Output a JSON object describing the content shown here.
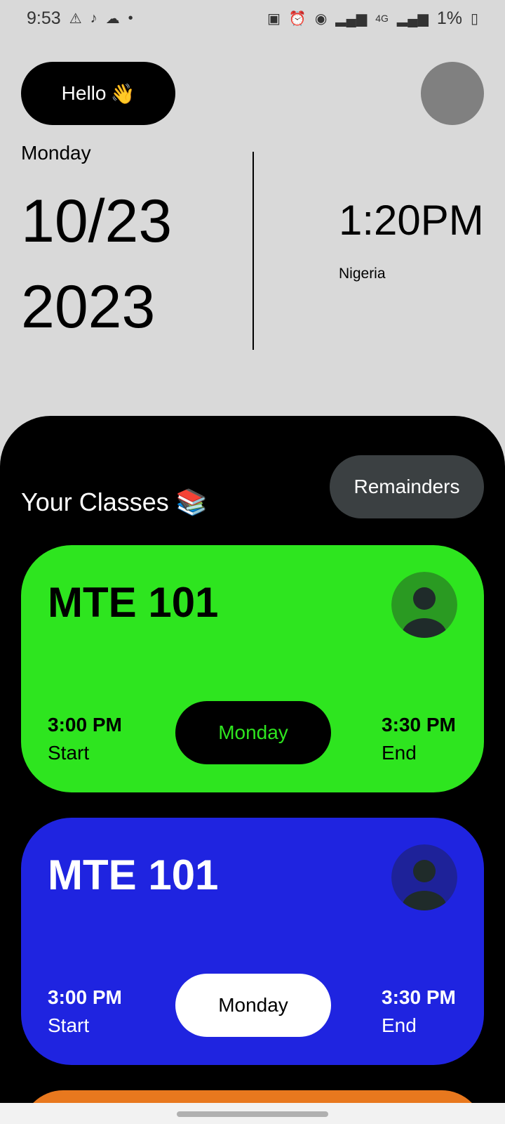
{
  "status_bar": {
    "time": "9:53",
    "battery": "1%",
    "network": "4G",
    "icons": [
      "warning-icon",
      "tiktok-icon",
      "cloud-icon",
      "dot-icon",
      "battery-saver-icon",
      "alarm-icon",
      "hotspot-icon",
      "signal-icon",
      "signal-icon",
      "battery-icon"
    ]
  },
  "header": {
    "greeting": "Hello",
    "greeting_emoji": "👋"
  },
  "date": {
    "day": "Monday",
    "month_day": "10/23",
    "year": "2023"
  },
  "clock": {
    "time": "1:20PM",
    "location": "Nigeria"
  },
  "classes": {
    "title": "Your Classes",
    "title_emoji": "📚",
    "reminders_label": "Remainders",
    "items": [
      {
        "code": "MTE 101",
        "start_time": "3:00 PM",
        "start_label": "Start",
        "day": "Monday",
        "end_time": "3:30 PM",
        "end_label": "End",
        "color": "#2ee51f"
      },
      {
        "code": "MTE 101",
        "start_time": "3:00 PM",
        "start_label": "Start",
        "day": "Monday",
        "end_time": "3:30 PM",
        "end_label": "End",
        "color": "#1f24e0"
      }
    ]
  },
  "colors": {
    "background": "#d9d9d9",
    "panel": "#000000",
    "reminders_button": "#3b4042",
    "third_card": "#e8781e"
  }
}
